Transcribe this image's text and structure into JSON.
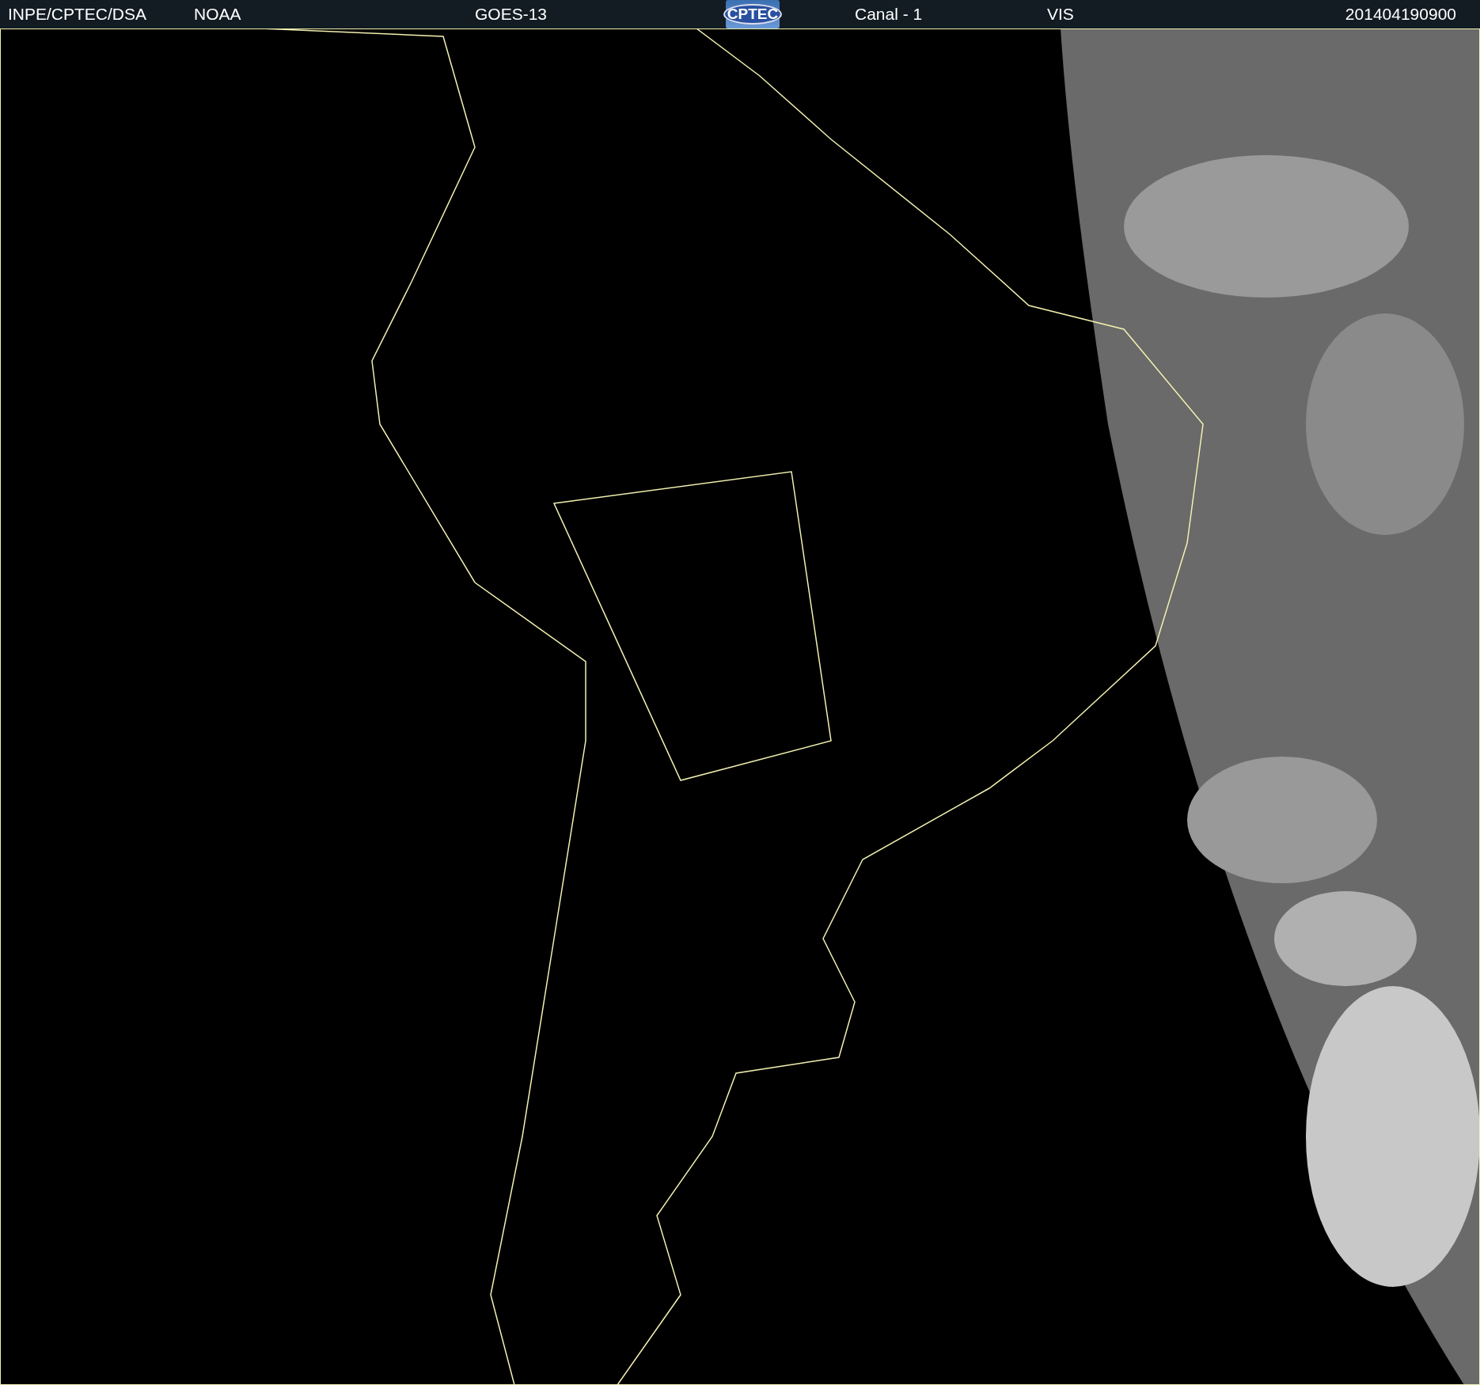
{
  "header": {
    "items": [
      {
        "kind": "text",
        "text": "INPE/CPTEC/DSA"
      },
      {
        "kind": "text",
        "text": "NOAA"
      },
      {
        "kind": "text",
        "text": "GOES-13"
      },
      {
        "kind": "logo",
        "text": "CPTEC"
      },
      {
        "kind": "text",
        "text": "Canal - 1"
      },
      {
        "kind": "text",
        "text": "VIS"
      },
      {
        "kind": "text",
        "text": "201404190900"
      }
    ]
  }
}
